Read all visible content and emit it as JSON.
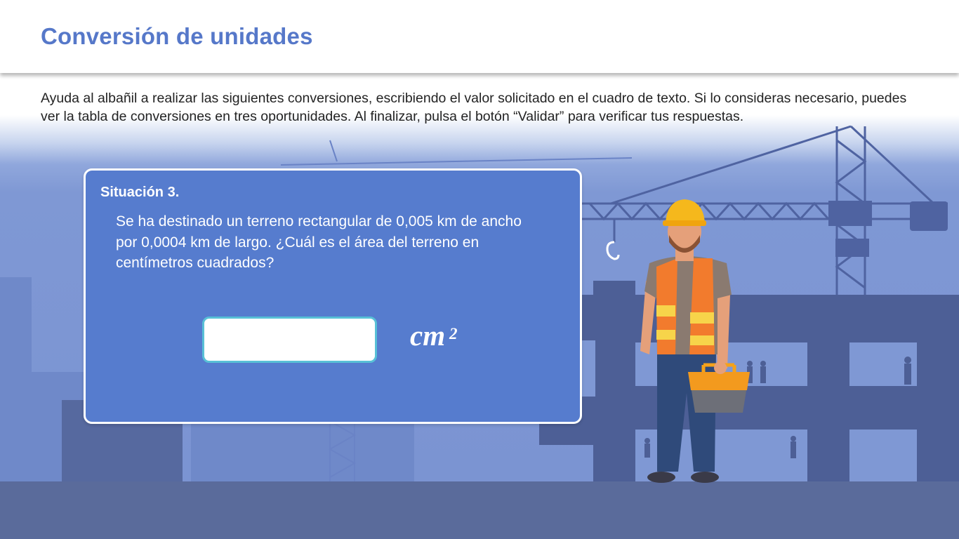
{
  "header": {
    "title": "Conversión de unidades"
  },
  "instructions": {
    "text": "Ayuda al albañil a realizar las siguientes conversiones, escribiendo el valor solicitado en el cuadro de texto. Si lo consideras necesario, puedes ver la tabla de conversiones en tres oportunidades. Al finalizar, pulsa el botón “Validar” para verificar tus respuestas."
  },
  "situation": {
    "title": "Situación 3.",
    "question": "Se ha destinado un terreno rectangular de 0,005 km de ancho por 0,0004 km de largo. ¿Cuál es el área del terreno en centímetros cuadrados?",
    "answer_value": "",
    "unit": "cm",
    "unit_exponent": "2"
  },
  "illustration": {
    "icons": [
      "construction-background",
      "builder-illustration",
      "toolbox-icon",
      "crane"
    ]
  },
  "colors": {
    "title": "#5678c9",
    "card_background": "#567cce",
    "input_border": "#58c0d6",
    "scene_background": "#7a93d2",
    "ground": "#5a6b9b",
    "building": "#4d5f96"
  }
}
